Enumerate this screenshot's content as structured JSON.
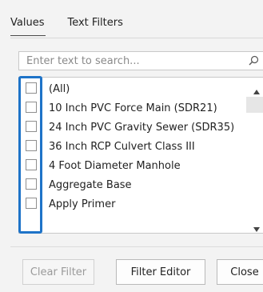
{
  "tabs": [
    {
      "label": "Values"
    },
    {
      "label": "Text Filters"
    }
  ],
  "search": {
    "placeholder": "Enter text to search..."
  },
  "items": [
    {
      "label": "(All)"
    },
    {
      "label": "10 Inch PVC Force Main (SDR21)"
    },
    {
      "label": "24 Inch PVC Gravity Sewer (SDR35)"
    },
    {
      "label": "36 Inch RCP Culvert Class III"
    },
    {
      "label": "4 Foot Diameter Manhole"
    },
    {
      "label": "Aggregate Base"
    },
    {
      "label": "Apply Primer"
    }
  ],
  "buttons": {
    "clear": "Clear Filter",
    "editor": "Filter Editor",
    "close": "Close"
  },
  "accent": "#1e73c8"
}
